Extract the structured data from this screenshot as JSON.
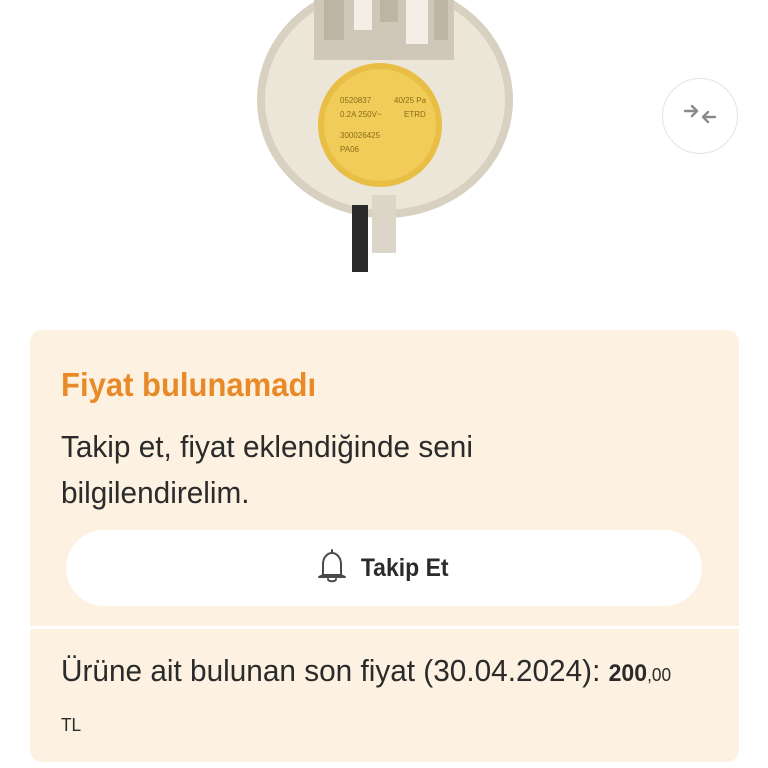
{
  "product": {
    "image_icon": "pressure-switch-photo"
  },
  "compare": {
    "icon": "compare-arrows-icon"
  },
  "price_card": {
    "title": "Fiyat bulunamadı",
    "message": "Takip et, fiyat eklendiğinde seni bilgilendirelim.",
    "follow_button": {
      "icon": "bell-icon",
      "label": "Takip Et"
    },
    "last_price_text": "Ürüne ait bulunan son fiyat (30.04.2024): ",
    "last_price_integer": "200",
    "last_price_decimal": ",00",
    "last_price_currency": " TL"
  },
  "colors": {
    "accent": "#e98a28",
    "card_background": "#fdf2e2",
    "text": "#2b2b2b"
  }
}
